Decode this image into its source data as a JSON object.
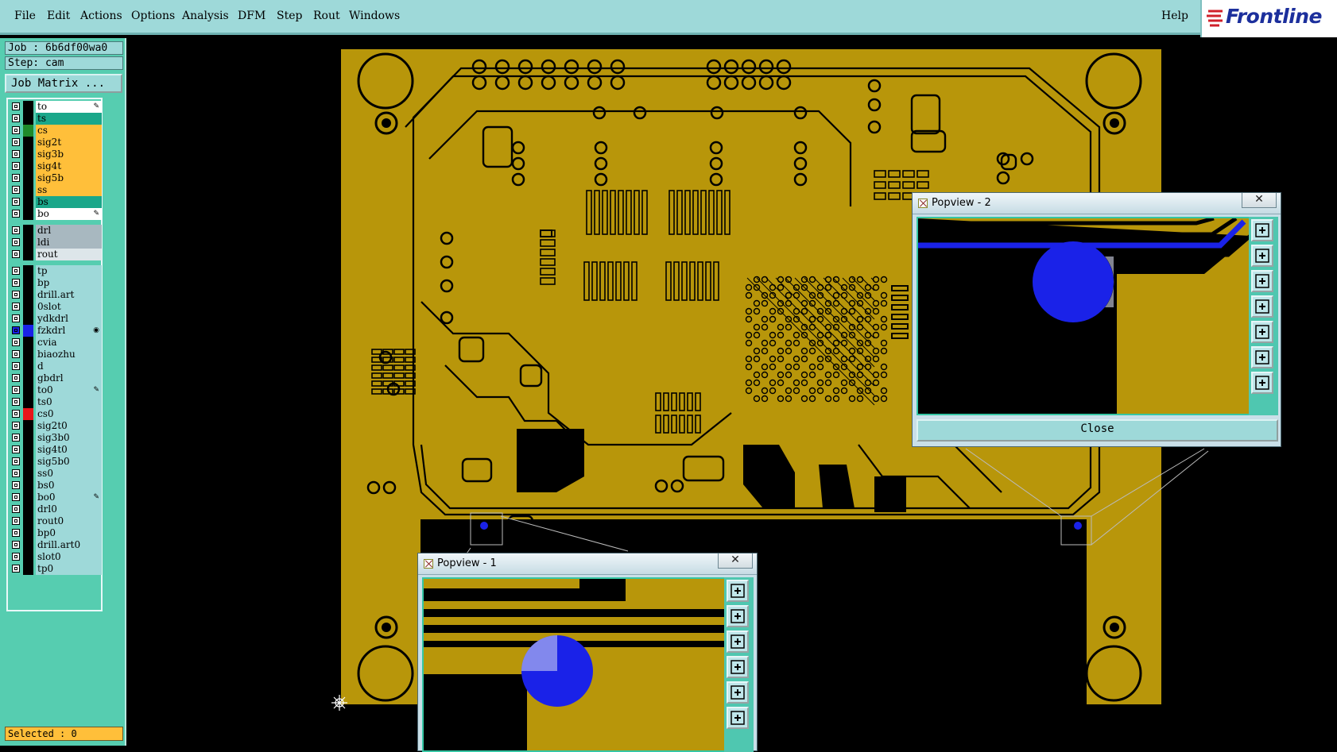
{
  "menubar": {
    "items": [
      "File",
      "Edit",
      "Actions",
      "Options",
      "Analysis",
      "DFM",
      "Step",
      "Rout",
      "Windows"
    ],
    "help": "Help"
  },
  "brand": {
    "name": "Frontline",
    "color": "#1c2f9c",
    "accent": "#d0202a"
  },
  "job": {
    "job_label": "Job : 6b6df00wa0",
    "step_label": "Step: cam",
    "matrix_button": "Job Matrix ..."
  },
  "layers": [
    {
      "name": "to",
      "color": "#ffffff",
      "swatch": "#000000",
      "mark": "pen"
    },
    {
      "name": "ts",
      "color": "#1aa78a",
      "swatch": "#000000"
    },
    {
      "name": "cs",
      "color": "#ffbf3a",
      "swatch": "#1f8a2a"
    },
    {
      "name": "sig2t",
      "color": "#ffbf3a",
      "swatch": "#000000"
    },
    {
      "name": "sig3b",
      "color": "#ffbf3a",
      "swatch": "#000000"
    },
    {
      "name": "sig4t",
      "color": "#ffbf3a",
      "swatch": "#000000"
    },
    {
      "name": "sig5b",
      "color": "#ffbf3a",
      "swatch": "#000000"
    },
    {
      "name": "ss",
      "color": "#ffbf3a",
      "swatch": "#000000"
    },
    {
      "name": "bs",
      "color": "#1aa78a",
      "swatch": "#000000"
    },
    {
      "name": "bo",
      "color": "#ffffff",
      "swatch": "#000000",
      "mark": "pen"
    },
    {
      "name": "drl",
      "color": "#a8b8c0",
      "swatch": "#000000"
    },
    {
      "name": "ldi",
      "color": "#a8b8c0",
      "swatch": "#000000"
    },
    {
      "name": "rout",
      "color": "#dde6ea",
      "swatch": "#000000"
    },
    {
      "name": "tp",
      "color": "#9ed9d9",
      "swatch": "#000000"
    },
    {
      "name": "bp",
      "color": "#9ed9d9",
      "swatch": "#000000"
    },
    {
      "name": "drill.art",
      "color": "#9ed9d9",
      "swatch": "#000000"
    },
    {
      "name": "0slot",
      "color": "#9ed9d9",
      "swatch": "#000000"
    },
    {
      "name": "ydkdrl",
      "color": "#9ed9d9",
      "swatch": "#000000"
    },
    {
      "name": "fzkdrl",
      "color": "#9ed9d9",
      "swatch": "#1a22e8",
      "mark": "dot"
    },
    {
      "name": "cvia",
      "color": "#9ed9d9",
      "swatch": "#000000"
    },
    {
      "name": "biaozhu",
      "color": "#9ed9d9",
      "swatch": "#000000"
    },
    {
      "name": "d",
      "color": "#9ed9d9",
      "swatch": "#000000"
    },
    {
      "name": "gbdrl",
      "color": "#9ed9d9",
      "swatch": "#000000"
    },
    {
      "name": "to0",
      "color": "#9ed9d9",
      "swatch": "#000000",
      "mark": "pen"
    },
    {
      "name": "ts0",
      "color": "#9ed9d9",
      "swatch": "#000000"
    },
    {
      "name": "cs0",
      "color": "#9ed9d9",
      "swatch": "#e8161a"
    },
    {
      "name": "sig2t0",
      "color": "#9ed9d9",
      "swatch": "#000000"
    },
    {
      "name": "sig3b0",
      "color": "#9ed9d9",
      "swatch": "#000000"
    },
    {
      "name": "sig4t0",
      "color": "#9ed9d9",
      "swatch": "#000000"
    },
    {
      "name": "sig5b0",
      "color": "#9ed9d9",
      "swatch": "#000000"
    },
    {
      "name": "ss0",
      "color": "#9ed9d9",
      "swatch": "#000000"
    },
    {
      "name": "bs0",
      "color": "#9ed9d9",
      "swatch": "#000000"
    },
    {
      "name": "bo0",
      "color": "#9ed9d9",
      "swatch": "#000000",
      "mark": "pen"
    },
    {
      "name": "drl0",
      "color": "#9ed9d9",
      "swatch": "#000000"
    },
    {
      "name": "rout0",
      "color": "#9ed9d9",
      "swatch": "#000000"
    },
    {
      "name": "bp0",
      "color": "#9ed9d9",
      "swatch": "#000000"
    },
    {
      "name": "drill.art0",
      "color": "#9ed9d9",
      "swatch": "#000000"
    },
    {
      "name": "slot0",
      "color": "#9ed9d9",
      "swatch": "#000000"
    },
    {
      "name": "tp0",
      "color": "#9ed9d9",
      "swatch": "#000000"
    }
  ],
  "status": {
    "selected": "Selected : 0"
  },
  "colors": {
    "board": "#b8960a",
    "trace": "#000000",
    "highlight": "#1a22e8"
  },
  "popview1": {
    "title": "Popview - 1",
    "close_icon": "✕"
  },
  "popview2": {
    "title": "Popview - 2",
    "close_icon": "✕",
    "close_button": "Close"
  }
}
